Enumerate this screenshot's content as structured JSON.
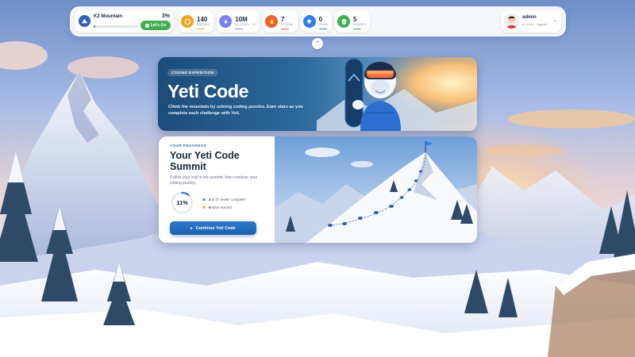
{
  "level": {
    "name": "K2 Mountain",
    "progress_text": "3%",
    "progress": 0.03,
    "cta": "Let's Go"
  },
  "stats": [
    {
      "value": "140",
      "label": "BADGES",
      "icon": "coin-icon",
      "color": "#f2a51c"
    },
    {
      "value": "10M",
      "label": "10 LEVEL - 30",
      "icon": "lightning-icon",
      "color": "#7b7ff0"
    },
    {
      "value": "7",
      "label": "STREAK",
      "icon": "flame-icon",
      "color": "#f0612c"
    },
    {
      "value": "0",
      "label": "GEMS",
      "icon": "diamond-icon",
      "color": "#2f7fe6"
    },
    {
      "value": "5",
      "label": "BADGES",
      "icon": "shield-check-icon",
      "color": "#3fb056"
    }
  ],
  "profile": {
    "name": "admin",
    "subtitle": "Lv 1013 · Legend"
  },
  "hero": {
    "badge": "CODING EXPEDITION",
    "title": "Yeti Code",
    "description": "Climb the mountain by solving coding puzzles. Earn stars as you complete each challenge with Yeti."
  },
  "progress_card": {
    "eyebrow": "YOUR PROGRESS",
    "title": "Your Yeti Code Summit",
    "description": "Follow your trail to the summit, then continue your coding journey.",
    "percent_text": "11%",
    "percent": 0.11,
    "levels_count": "3",
    "levels_text": "of 27 levels complete",
    "stars_count": "9",
    "stars_text": "stars earned",
    "button": "Continue Yeti Code"
  }
}
